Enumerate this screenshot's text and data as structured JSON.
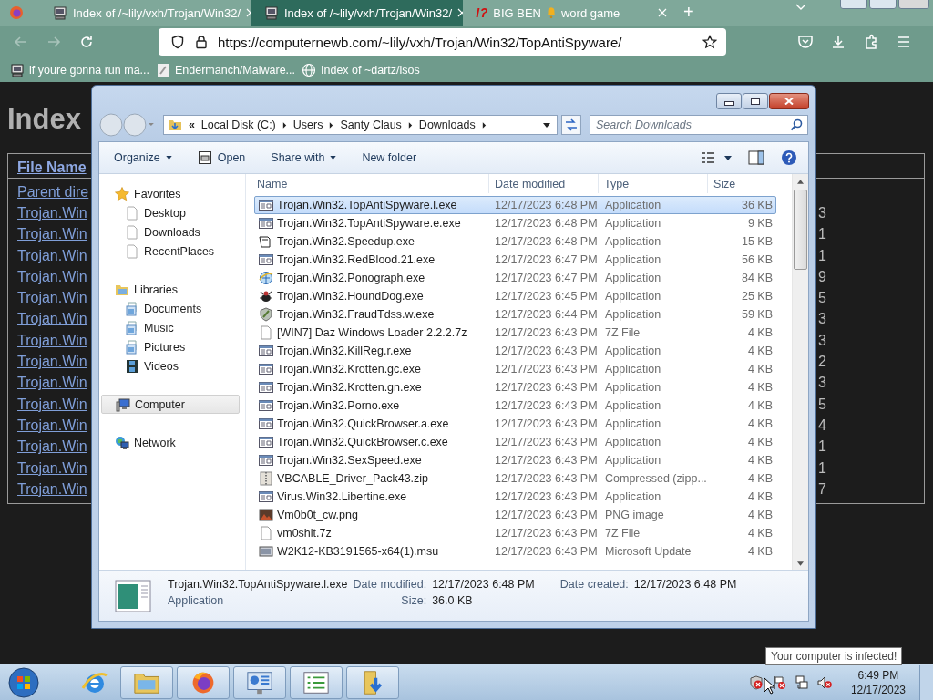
{
  "browser": {
    "tabs": [
      {
        "title": "Index of /~lily/vxh/Trojan/Win32/",
        "kind": "server",
        "selected": false
      },
      {
        "title": "Index of /~lily/vxh/Trojan/Win32/",
        "kind": "server",
        "selected": true
      },
      {
        "title": "BIG BEN",
        "title_end": "word game",
        "kind": "alert",
        "mark": "!?",
        "selected": false
      }
    ],
    "new_tab": "+",
    "nav_buttons": [
      {
        "kind": "back",
        "disabled": true
      },
      {
        "kind": "forward",
        "disabled": true
      },
      {
        "kind": "reload",
        "disabled": false
      }
    ],
    "url": "https://computernewb.com/~lily/vxh/Trojan/Win32/TopAntiSpyware/",
    "bookmarks": [
      {
        "label": "if youre gonna run ma...",
        "kind": "server"
      },
      {
        "label": "Endermanch/Malware...",
        "kind": "page"
      },
      {
        "label": "Index of ~dartz/isos",
        "kind": "globe"
      }
    ]
  },
  "page": {
    "heading": "Index",
    "column": "File Name",
    "rows": [
      {
        "name": "Parent dire"
      },
      {
        "name": "Trojan.Win",
        "end": "3"
      },
      {
        "name": "Trojan.Win",
        "end": "1"
      },
      {
        "name": "Trojan.Win",
        "end": "1"
      },
      {
        "name": "Trojan.Win",
        "end": "9"
      },
      {
        "name": "Trojan.Win",
        "end": "5"
      },
      {
        "name": "Trojan.Win",
        "end": "3"
      },
      {
        "name": "Trojan.Win",
        "end": "3"
      },
      {
        "name": "Trojan.Win",
        "end": "2"
      },
      {
        "name": "Trojan.Win",
        "end": "3"
      },
      {
        "name": "Trojan.Win",
        "end": "5"
      },
      {
        "name": "Trojan.Win",
        "end": "4"
      },
      {
        "name": "Trojan.Win",
        "end": "1"
      },
      {
        "name": "Trojan.Win",
        "end": "1"
      },
      {
        "name": "Trojan.Win",
        "end": "7"
      }
    ]
  },
  "explorer": {
    "overflow": "«",
    "path": [
      "Local Disk (C:)",
      "Users",
      "Santy Claus",
      "Downloads"
    ],
    "search_placeholder": "Search Downloads",
    "toolbar": [
      {
        "label": "Organize",
        "kind": "menu"
      },
      {
        "label": "Open",
        "kind": "open"
      },
      {
        "label": "Share with",
        "kind": "menu"
      },
      {
        "label": "New folder",
        "kind": "plain"
      }
    ],
    "nav": [
      {
        "label": "Favorites",
        "kind": "star",
        "selected": false,
        "children": [
          {
            "label": "Desktop",
            "kind": "page",
            "selected": false
          },
          {
            "label": "Downloads",
            "kind": "page",
            "selected": false
          },
          {
            "label": "RecentPlaces",
            "kind": "page",
            "selected": false
          }
        ]
      },
      {
        "label": "Libraries",
        "kind": "library",
        "selected": false,
        "children": [
          {
            "label": "Documents",
            "kind": "libdoc",
            "selected": false
          },
          {
            "label": "Music",
            "kind": "libdoc",
            "selected": false
          },
          {
            "label": "Pictures",
            "kind": "libdoc",
            "selected": false
          },
          {
            "label": "Videos",
            "kind": "film",
            "selected": false
          }
        ]
      },
      {
        "label": "Computer",
        "kind": "computer",
        "selected": true
      },
      {
        "label": "Network",
        "kind": "network",
        "selected": false
      }
    ],
    "columns": [
      "Name",
      "Date modified",
      "Type",
      "Size"
    ],
    "files": [
      {
        "name": "Trojan.Win32.TopAntiSpyware.l.exe",
        "modified": "12/17/2023 6:48 PM",
        "type": "Application",
        "size": "36 KB",
        "kind": "app",
        "selected": true
      },
      {
        "name": "Trojan.Win32.TopAntiSpyware.e.exe",
        "modified": "12/17/2023 6:48 PM",
        "type": "Application",
        "size": "9 KB",
        "kind": "app",
        "selected": false
      },
      {
        "name": "Trojan.Win32.Speedup.exe",
        "modified": "12/17/2023 6:48 PM",
        "type": "Application",
        "size": "15 KB",
        "kind": "outline",
        "selected": false
      },
      {
        "name": "Trojan.Win32.RedBlood.21.exe",
        "modified": "12/17/2023 6:47 PM",
        "type": "Application",
        "size": "56 KB",
        "kind": "app",
        "selected": false
      },
      {
        "name": "Trojan.Win32.Ponograph.exe",
        "modified": "12/17/2023 6:47 PM",
        "type": "Application",
        "size": "84 KB",
        "kind": "globe",
        "selected": false
      },
      {
        "name": "Trojan.Win32.HoundDog.exe",
        "modified": "12/17/2023 6:45 PM",
        "type": "Application",
        "size": "25 KB",
        "kind": "bug",
        "selected": false
      },
      {
        "name": "Trojan.Win32.FraudTdss.w.exe",
        "modified": "12/17/2023 6:44 PM",
        "type": "Application",
        "size": "59 KB",
        "kind": "shield",
        "selected": false
      },
      {
        "name": "[WIN7] Daz Windows Loader 2.2.2.7z",
        "modified": "12/17/2023 6:43 PM",
        "type": "7Z File",
        "size": "4 KB",
        "kind": "file",
        "selected": false
      },
      {
        "name": "Trojan.Win32.KillReg.r.exe",
        "modified": "12/17/2023 6:43 PM",
        "type": "Application",
        "size": "4 KB",
        "kind": "app",
        "selected": false
      },
      {
        "name": "Trojan.Win32.Krotten.gc.exe",
        "modified": "12/17/2023 6:43 PM",
        "type": "Application",
        "size": "4 KB",
        "kind": "app",
        "selected": false
      },
      {
        "name": "Trojan.Win32.Krotten.gn.exe",
        "modified": "12/17/2023 6:43 PM",
        "type": "Application",
        "size": "4 KB",
        "kind": "app",
        "selected": false
      },
      {
        "name": "Trojan.Win32.Porno.exe",
        "modified": "12/17/2023 6:43 PM",
        "type": "Application",
        "size": "4 KB",
        "kind": "app",
        "selected": false
      },
      {
        "name": "Trojan.Win32.QuickBrowser.a.exe",
        "modified": "12/17/2023 6:43 PM",
        "type": "Application",
        "size": "4 KB",
        "kind": "app",
        "selected": false
      },
      {
        "name": "Trojan.Win32.QuickBrowser.c.exe",
        "modified": "12/17/2023 6:43 PM",
        "type": "Application",
        "size": "4 KB",
        "kind": "app",
        "selected": false
      },
      {
        "name": "Trojan.Win32.SexSpeed.exe",
        "modified": "12/17/2023 6:43 PM",
        "type": "Application",
        "size": "4 KB",
        "kind": "app",
        "selected": false
      },
      {
        "name": "VBCABLE_Driver_Pack43.zip",
        "modified": "12/17/2023 6:43 PM",
        "type": "Compressed (zipp...",
        "size": "4 KB",
        "kind": "zip",
        "selected": false
      },
      {
        "name": "Virus.Win32.Libertine.exe",
        "modified": "12/17/2023 6:43 PM",
        "type": "Application",
        "size": "4 KB",
        "kind": "app",
        "selected": false
      },
      {
        "name": "Vm0b0t_cw.png",
        "modified": "12/17/2023 6:43 PM",
        "type": "PNG image",
        "size": "4 KB",
        "kind": "image",
        "selected": false
      },
      {
        "name": "vm0shit.7z",
        "modified": "12/17/2023 6:43 PM",
        "type": "7Z File",
        "size": "4 KB",
        "kind": "file",
        "selected": false
      },
      {
        "name": "W2K12-KB3191565-x64(1).msu",
        "modified": "12/17/2023 6:43 PM",
        "type": "Microsoft Update",
        "size": "4 KB",
        "kind": "installer",
        "selected": false
      }
    ],
    "details": {
      "name": "Trojan.Win32.TopAntiSpyware.l.exe",
      "type": "Application",
      "modified_label": "Date modified:",
      "modified": "12/17/2023 6:48 PM",
      "size_label": "Size:",
      "size": "36.0 KB",
      "created_label": "Date created:",
      "created": "12/17/2023 6:48 PM"
    }
  },
  "taskbar": {
    "apps": [
      {
        "kind": "ie"
      },
      {
        "kind": "explorer"
      },
      {
        "kind": "firefox"
      },
      {
        "kind": "control"
      },
      {
        "kind": "list"
      },
      {
        "kind": "downloads"
      }
    ],
    "tooltip": "Your computer is infected!",
    "tray": [
      {
        "kind": "shield-alert"
      },
      {
        "kind": "flag"
      },
      {
        "kind": "network"
      },
      {
        "kind": "volume-muted"
      }
    ],
    "time": "6:49 PM",
    "date": "12/17/2023"
  }
}
